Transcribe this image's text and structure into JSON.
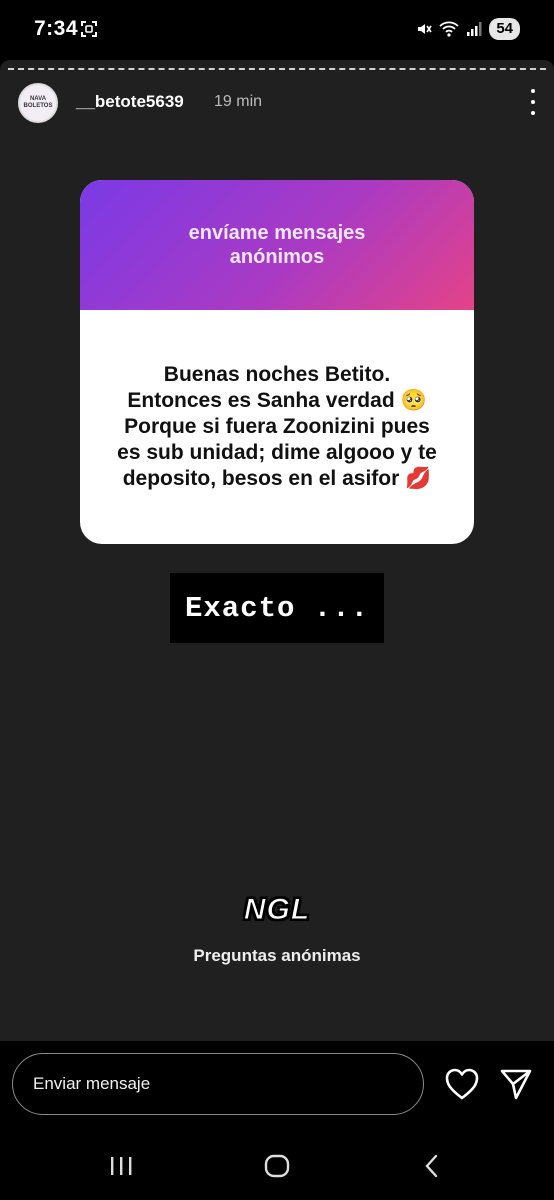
{
  "status_bar": {
    "time": "7:34",
    "battery": "54"
  },
  "story": {
    "avatar_text": "NAVA BOLETOS",
    "username": "__betote5639",
    "timestamp": "19 min",
    "card": {
      "title": "envíame mensajes anónimos",
      "message": "Buenas noches Betito. Entonces es Sanha verdad 🥺 Porque si fuera Zoonizini pues es sub unidad; dime algooo y te deposito, besos en el asifor 💋"
    },
    "reply_label": "Exacto ...",
    "brand": {
      "logo": "NGL",
      "tagline": "Preguntas anónimas"
    }
  },
  "reply_bar": {
    "placeholder": "Enviar mensaje"
  },
  "icons": {
    "screenshot": "screenshot-icon",
    "mute": "mute-icon",
    "wifi": "wifi-icon",
    "signal": "signal-icon",
    "more": "more-vertical-icon",
    "heart": "heart-icon",
    "send": "send-icon",
    "recents": "recents-icon",
    "home": "home-icon",
    "back": "back-icon"
  },
  "colors": {
    "story_background": "#202020",
    "card_gradient_start": "#7a3ae6",
    "card_gradient_end": "#e44388"
  }
}
